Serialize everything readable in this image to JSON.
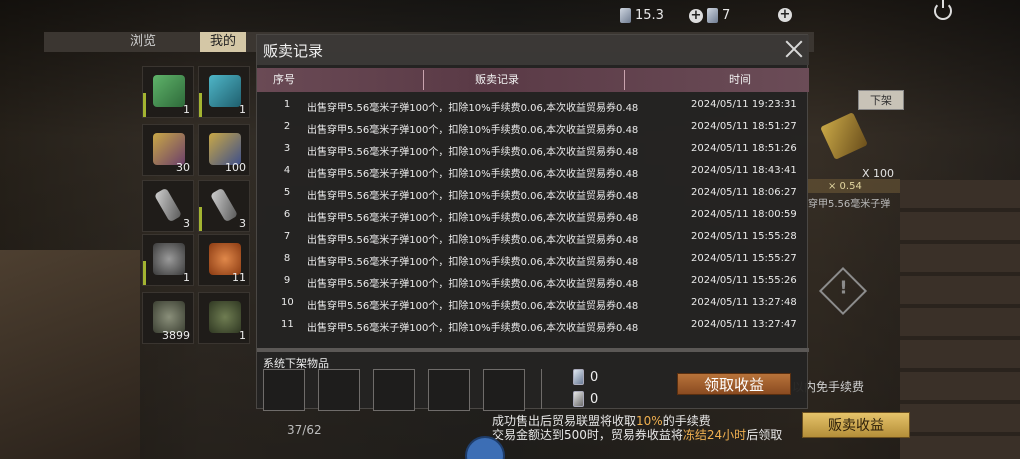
{
  "topbar": {
    "stat1_value": "15.3",
    "stat2_value": "7"
  },
  "tabs": {
    "browse": "浏览",
    "mine": "我的"
  },
  "inventory": {
    "slots": [
      {
        "count": "1",
        "art": "green-box-icon"
      },
      {
        "count": "1",
        "art": "teal-box-icon"
      },
      {
        "count": "30",
        "art": "ammo-box-icon"
      },
      {
        "count": "100",
        "art": "ammo-box-blue-icon"
      },
      {
        "count": "3",
        "art": "grenade-shell-icon"
      },
      {
        "count": "3",
        "art": "grenade-shell-icon"
      },
      {
        "count": "1",
        "art": "helmet-icon"
      },
      {
        "count": "11",
        "art": "roast-chicken-icon"
      },
      {
        "count": "3899",
        "art": "gunpowder-icon"
      },
      {
        "count": "1",
        "art": "frag-grenade-icon"
      }
    ],
    "capacity": "37/62"
  },
  "right_panel": {
    "off_shelf_label": "下架",
    "quantity": "X 100",
    "price": "× 0.54",
    "name": "穿甲5.56毫米子弹"
  },
  "modal": {
    "title": "贩卖记录",
    "headers": {
      "no": "序号",
      "record": "贩卖记录",
      "time": "时间"
    },
    "rows": [
      {
        "no": "1",
        "record": "出售穿甲5.56毫米子弹100个，扣除10%手续费0.06,本次收益贸易券0.48",
        "time": "2024/05/11 19:23:31"
      },
      {
        "no": "2",
        "record": "出售穿甲5.56毫米子弹100个，扣除10%手续费0.06,本次收益贸易券0.48",
        "time": "2024/05/11 18:51:27"
      },
      {
        "no": "3",
        "record": "出售穿甲5.56毫米子弹100个，扣除10%手续费0.06,本次收益贸易券0.48",
        "time": "2024/05/11 18:51:26"
      },
      {
        "no": "4",
        "record": "出售穿甲5.56毫米子弹100个，扣除10%手续费0.06,本次收益贸易券0.48",
        "time": "2024/05/11 18:43:41"
      },
      {
        "no": "5",
        "record": "出售穿甲5.56毫米子弹100个，扣除10%手续费0.06,本次收益贸易券0.48",
        "time": "2024/05/11 18:06:27"
      },
      {
        "no": "6",
        "record": "出售穿甲5.56毫米子弹100个，扣除10%手续费0.06,本次收益贸易券0.48",
        "time": "2024/05/11 18:00:59"
      },
      {
        "no": "7",
        "record": "出售穿甲5.56毫米子弹100个，扣除10%手续费0.06,本次收益贸易券0.48",
        "time": "2024/05/11 15:55:28"
      },
      {
        "no": "8",
        "record": "出售穿甲5.56毫米子弹100个，扣除10%手续费0.06,本次收益贸易券0.48",
        "time": "2024/05/11 15:55:27"
      },
      {
        "no": "9",
        "record": "出售穿甲5.56毫米子弹100个，扣除10%手续费0.06,本次收益贸易券0.48",
        "time": "2024/05/11 15:55:26"
      },
      {
        "no": "10",
        "record": "出售穿甲5.56毫米子弹100个，扣除10%手续费0.06,本次收益贸易券0.48",
        "time": "2024/05/11 13:27:48"
      },
      {
        "no": "11",
        "record": "出售穿甲5.56毫米子弹100个，扣除10%手续费0.06,本次收益贸易券0.48",
        "time": "2024/05/11 13:27:47"
      }
    ],
    "system_removed_label": "系统下架物品",
    "coin1_value": "0",
    "coin2_value": "0",
    "claim_label": "领取收益"
  },
  "bottom": {
    "fee_line1_pre": "成功售出后贸易联盟将收取",
    "fee_line1_hl": "10%",
    "fee_line1_post": "的手续费",
    "fee_line2_pre": "交易金额达到500时，贸易券收益将",
    "fee_line2_hl": "冻结24小时",
    "fee_line2_post": "后领取",
    "sell_profit_label": "贩卖收益",
    "free_fee_text": "以内免手续费"
  },
  "colors": {
    "accent_green": "#a3b431",
    "header_rose": "#6a4a55",
    "claim_orange": "#b8733a",
    "sell_gold": "#e5c36a",
    "highlight": "#f0b050"
  }
}
